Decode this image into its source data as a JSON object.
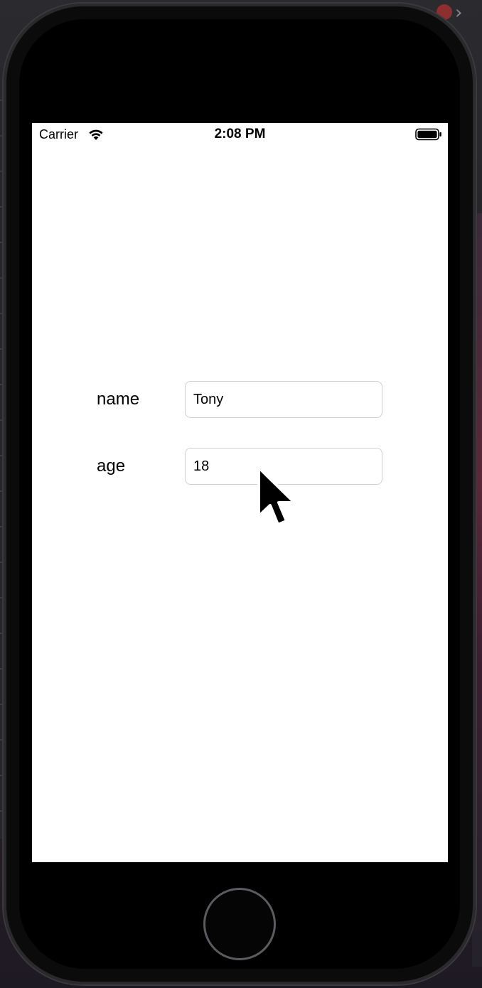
{
  "status_bar": {
    "carrier": "Carrier",
    "time": "2:08 PM",
    "wifi_icon": "wifi-icon",
    "battery_icon": "battery-full-icon"
  },
  "form": {
    "name": {
      "label": "name",
      "value": "Tony"
    },
    "age": {
      "label": "age",
      "value": "18"
    }
  },
  "device": {
    "home_button_icon": "home-button",
    "pointer_icon": "mouse-pointer-icon"
  },
  "colors": {
    "screen_background": "#ffffff",
    "field_border": "#d0d0d3",
    "device_body": "#0b0b0b"
  }
}
